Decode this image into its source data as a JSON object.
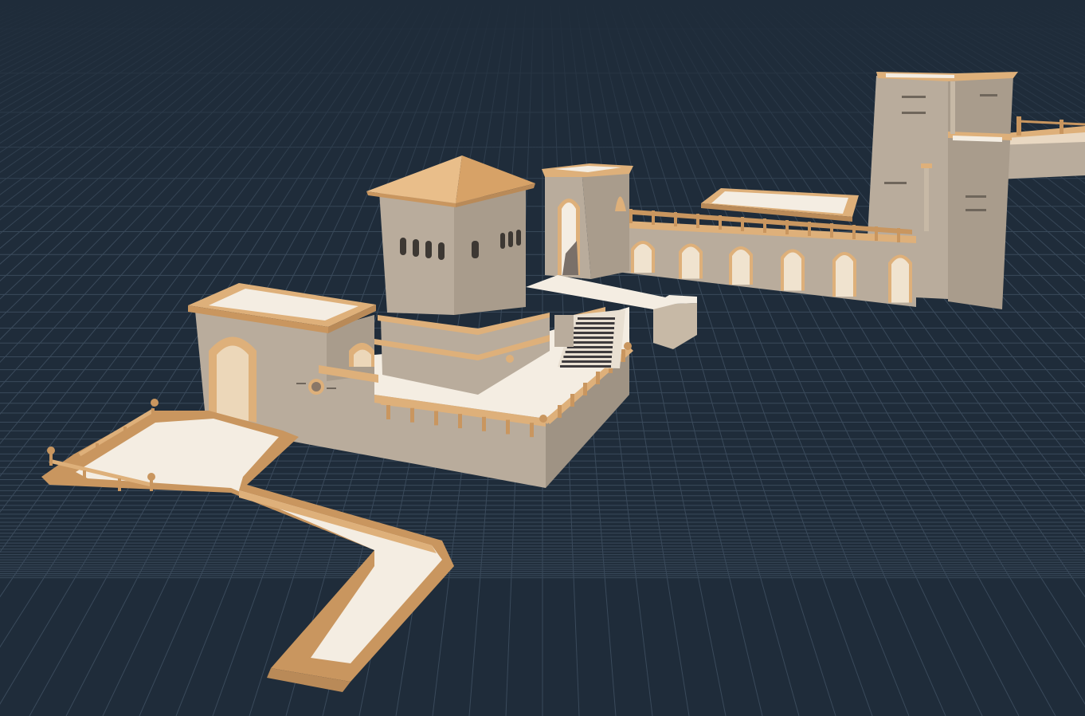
{
  "scene": {
    "view": "3d-editor-viewport",
    "ground": "grid-floor",
    "objects": [
      "path-walkway",
      "terrace-platform",
      "gate-building",
      "square-tower",
      "hip-roof",
      "stairway",
      "archway-pavilion",
      "arched-bridge",
      "rooftop-slab",
      "tall-tower",
      "far-bridge"
    ]
  },
  "colors": {
    "background": "#1f2c3a",
    "grid_line": "#3a4a5b",
    "stone": "#b9ac9c",
    "stone_dark": "#8f8578",
    "trim": "#deb07a",
    "trim_dark": "#b98a58",
    "floor": "#f4ede2",
    "roof": "#e7b47b"
  }
}
